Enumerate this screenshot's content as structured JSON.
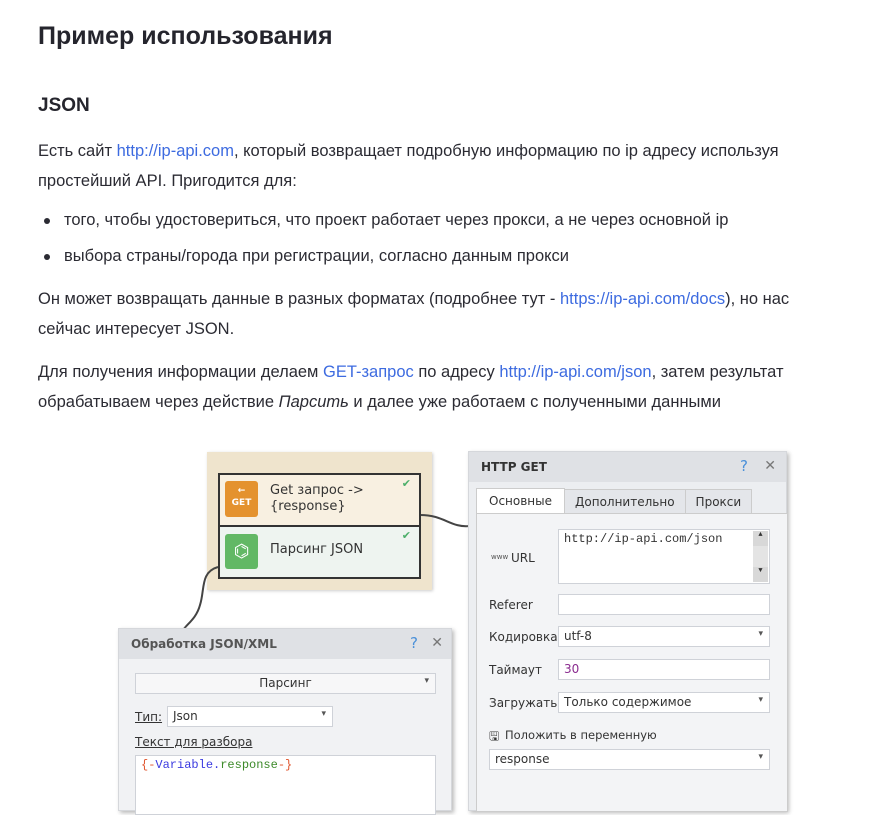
{
  "title": "Пример использования",
  "subtitle": "JSON",
  "p1": {
    "a": "Есть сайт ",
    "link": "http://ip-api.com",
    "b": ", который возвращает подробную информацию по ip адресу используя",
    "c": "простейший API. Пригодится для:"
  },
  "bullets": [
    "того, чтобы удостовериться, что проект работает через прокси, а не через основной ip",
    "выбора страны/города при регистрации, согласно данным прокси"
  ],
  "p2": {
    "a": "Он может возвращать данные в разных форматах (подробнее тут - ",
    "link": "https://ip-api.com/docs",
    "b": "), но нас",
    "c": "сейчас интересует JSON."
  },
  "p3": {
    "a": "Для получения информации делаем ",
    "link1": "GET-запрос",
    "b": " по адресу ",
    "link2": "http://ip-api.com/json",
    "c": ", затем результат",
    "d": "обрабатываем через действие ",
    "em": "Парсить",
    "e": "  и далее уже работаем с полученными данными"
  },
  "nodes": [
    {
      "badge": "GET",
      "label1": "Get запрос ->",
      "label2": "{response}"
    },
    {
      "label1": "Парсинг JSON"
    }
  ],
  "http": {
    "title": "HTTP GET",
    "help": "?",
    "close": "✕",
    "tabs": [
      "Основные",
      "Дополнительно",
      "Прокси"
    ],
    "url_label": "URL",
    "url_icon": "www",
    "url": "http://ip-api.com/json",
    "referer_label": "Referer",
    "referer": "",
    "enc_label": "Кодировка",
    "enc": "utf-8",
    "timeout_label": "Таймаут",
    "timeout": "30",
    "load_label": "Загружать",
    "load": "Только содержимое",
    "var_label": "Положить в переменную",
    "var": "response"
  },
  "json": {
    "title": "Обработка JSON/XML",
    "help": "?",
    "close": "✕",
    "mode": "Парсинг",
    "type_label": "Тип:",
    "type": "Json",
    "text_label": "Текст для разбора",
    "text_a": "{-",
    "text_b": "Variable.",
    "text_c": "response",
    "text_d": "-}"
  }
}
